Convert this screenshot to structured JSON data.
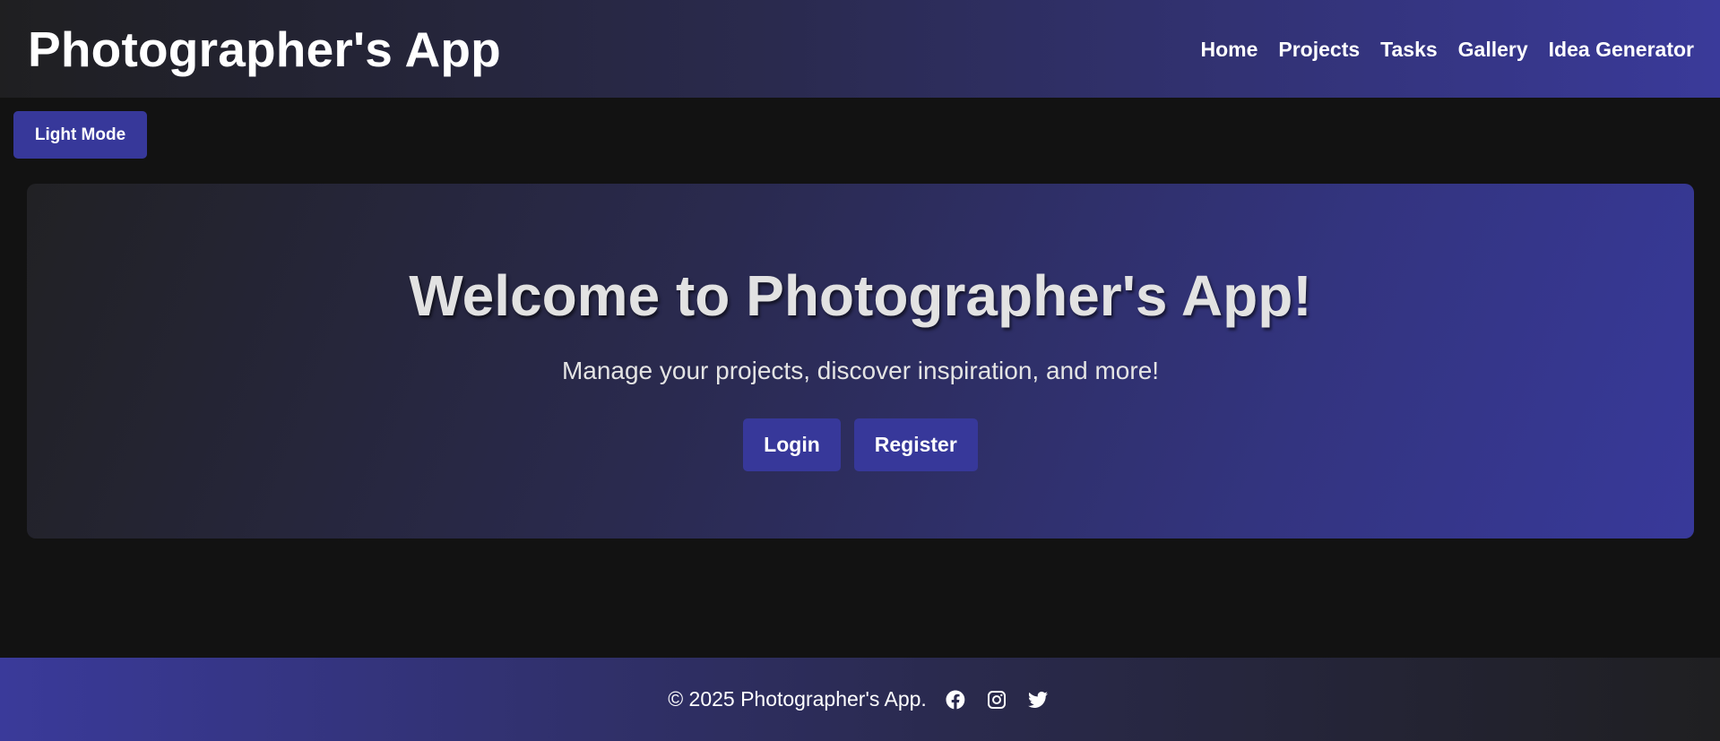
{
  "header": {
    "title": "Photographer's App",
    "nav": [
      {
        "label": "Home"
      },
      {
        "label": "Projects"
      },
      {
        "label": "Tasks"
      },
      {
        "label": "Gallery"
      },
      {
        "label": "Idea Generator"
      }
    ]
  },
  "theme_toggle": {
    "label": "Light Mode"
  },
  "hero": {
    "title": "Welcome to Photographer's App!",
    "subtitle": "Manage your projects, discover inspiration, and more!",
    "login_label": "Login",
    "register_label": "Register"
  },
  "footer": {
    "text": "© 2025 Photographer's App.",
    "social": [
      {
        "icon": "facebook-icon"
      },
      {
        "icon": "instagram-icon"
      },
      {
        "icon": "twitter-icon"
      }
    ]
  },
  "colors": {
    "background": "#121212",
    "accent": "#37389a",
    "text": "#ffffff"
  }
}
